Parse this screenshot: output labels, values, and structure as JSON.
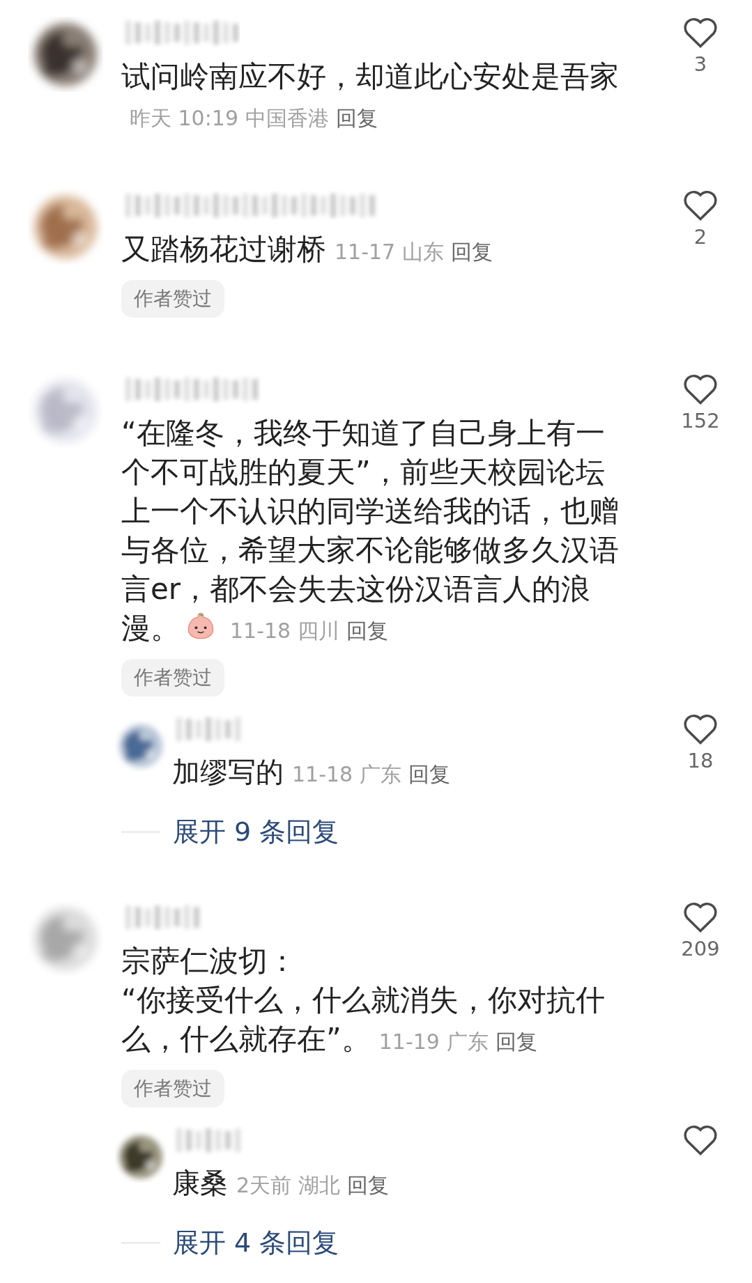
{
  "comments": [
    {
      "text": "试问岭南应不好，却道此心安处是吾家",
      "sticker": false,
      "date": "昨天 10:19",
      "location": "中国香港",
      "reply": "回复",
      "likes": "3",
      "author_liked": false
    },
    {
      "text": "又踏杨花过谢桥",
      "sticker": false,
      "date": "11-17",
      "location": "山东",
      "reply": "回复",
      "likes": "2",
      "author_liked": true,
      "badge": "作者赞过"
    },
    {
      "text": "“在隆冬，我终于知道了自己身上有一个不可战胜的夏天”，前些天校园论坛上一个不认识的同学送给我的话，也赠与各位，希望大家不论能够做多久汉语言er，都不会失去这份汉语言人的浪漫。",
      "sticker": true,
      "date": "11-18",
      "location": "四川",
      "reply": "回复",
      "likes": "152",
      "author_liked": true,
      "badge": "作者赞过",
      "replies": [
        {
          "text": "加缪写的",
          "date": "11-18",
          "location": "广东",
          "reply": "回复",
          "likes": "18"
        }
      ],
      "expand": "展开 9 条回复"
    },
    {
      "text": "宗萨仁波切：\n“你接受什么，什么就消失，你对抗什么，什么就存在”。",
      "sticker": false,
      "date": "11-19",
      "location": "广东",
      "reply": "回复",
      "likes": "209",
      "author_liked": true,
      "badge": "作者赞过",
      "replies": [
        {
          "text": "康桑",
          "date": "2天前",
          "location": "湖北",
          "reply": "回复"
        }
      ],
      "expand": "展开 4 条回复"
    }
  ]
}
